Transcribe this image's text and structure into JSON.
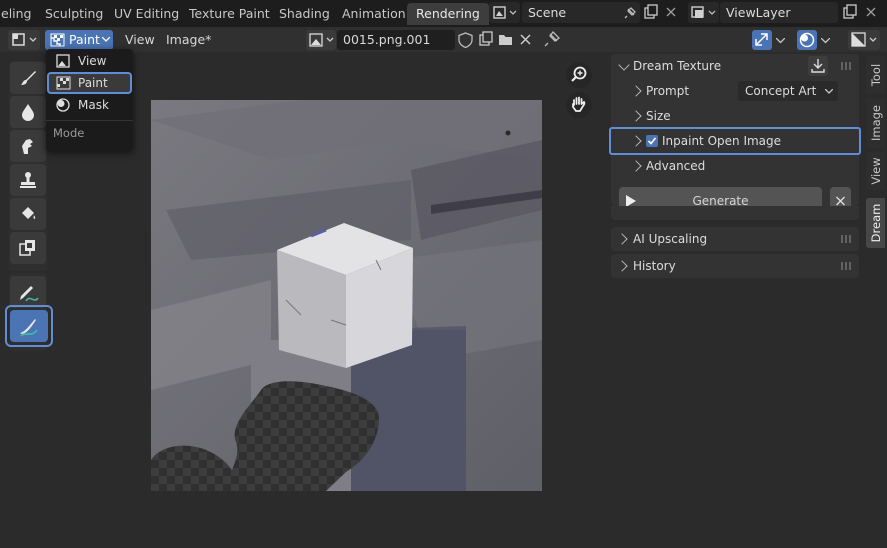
{
  "workspace_tabs": [
    {
      "label": "eling"
    },
    {
      "label": "Sculpting"
    },
    {
      "label": "UV Editing"
    },
    {
      "label": "Texture Paint"
    },
    {
      "label": "Shading"
    },
    {
      "label": "Animation"
    },
    {
      "label": "Rendering"
    }
  ],
  "scene": {
    "name": "Scene"
  },
  "view_layer": {
    "name": "ViewLayer"
  },
  "header": {
    "mode_label": "Paint",
    "menu_view": "View",
    "menu_image": "Image*",
    "image_name": "0015.png.001"
  },
  "mode_menu": {
    "items": [
      {
        "label": "View"
      },
      {
        "label": "Paint"
      },
      {
        "label": "Mask"
      }
    ],
    "footer": "Mode",
    "selected": "Paint"
  },
  "dream_panel": {
    "title": "Dream Texture",
    "prompt_label": "Prompt",
    "prompt_preset": "Concept Art",
    "size_label": "Size",
    "inpaint_label": "Inpaint Open Image",
    "inpaint_checked": true,
    "advanced_label": "Advanced",
    "generate_label": "Generate"
  },
  "subpanels": {
    "upscaling": "AI Upscaling",
    "history": "History"
  },
  "side_tabs": [
    {
      "label": "Tool"
    },
    {
      "label": "Image"
    },
    {
      "label": "View"
    },
    {
      "label": "Dream"
    }
  ],
  "colors": {
    "accent": "#5f8ed6",
    "active_tool": "#4a74b4",
    "panel": "#333333"
  }
}
